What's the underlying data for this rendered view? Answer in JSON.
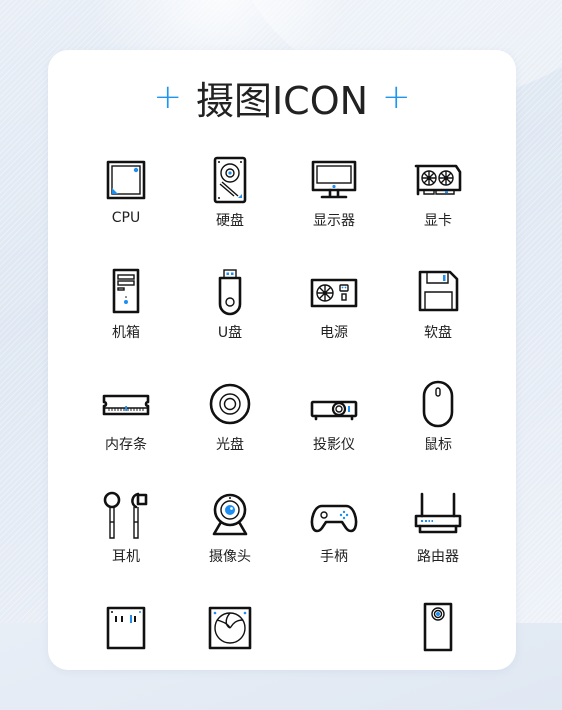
{
  "title": {
    "left_mark": "+",
    "text": "摄图ICON",
    "right_mark": "+"
  },
  "colors": {
    "accent": "#1e8ef0",
    "stroke": "#111111",
    "card": "#ffffff",
    "background": "#e4ebf4"
  },
  "icons": [
    {
      "name": "cpu-icon",
      "label": "CPU"
    },
    {
      "name": "hard-disk-icon",
      "label": "硬盘"
    },
    {
      "name": "monitor-icon",
      "label": "显示器"
    },
    {
      "name": "graphics-card-icon",
      "label": "显卡"
    },
    {
      "name": "computer-case-icon",
      "label": "机箱"
    },
    {
      "name": "usb-drive-icon",
      "label": "U盘"
    },
    {
      "name": "power-supply-icon",
      "label": "电源"
    },
    {
      "name": "floppy-disk-icon",
      "label": "软盘"
    },
    {
      "name": "memory-stick-icon",
      "label": "内存条"
    },
    {
      "name": "optical-disc-icon",
      "label": "光盘"
    },
    {
      "name": "projector-icon",
      "label": "投影仪"
    },
    {
      "name": "mouse-icon",
      "label": "鼠标"
    },
    {
      "name": "earphones-icon",
      "label": "耳机"
    },
    {
      "name": "webcam-icon",
      "label": "摄像头"
    },
    {
      "name": "gamepad-icon",
      "label": "手柄"
    },
    {
      "name": "router-icon",
      "label": "路由器"
    },
    {
      "name": "motherboard-icon",
      "label": ""
    },
    {
      "name": "cooling-fan-icon",
      "label": ""
    },
    {
      "name": "blank-slot-icon",
      "label": ""
    },
    {
      "name": "speaker-icon",
      "label": ""
    }
  ]
}
